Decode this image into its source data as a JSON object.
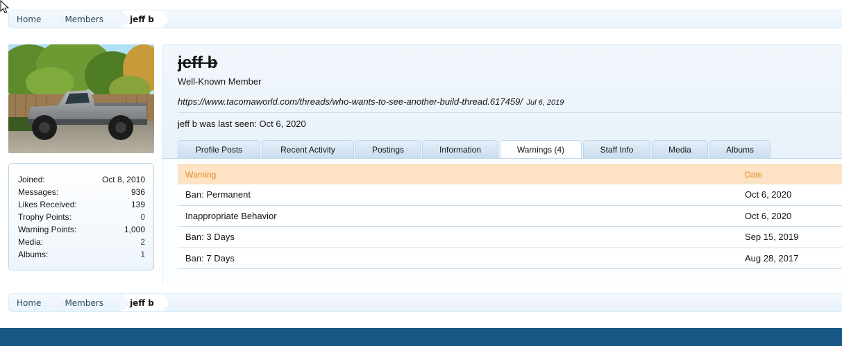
{
  "breadcrumb": {
    "items": [
      "Home",
      "Members",
      "jeff b"
    ]
  },
  "profile": {
    "username": "jeff b",
    "user_title": "Well-Known Member",
    "status_text": "https://www.tacomaworld.com/threads/who-wants-to-see-another-build-thread.617459/",
    "status_date": "Jul 6, 2019",
    "last_seen": "jeff b was last seen: Oct 6, 2020"
  },
  "stats": [
    {
      "label": "Joined:",
      "value": "Oct 8, 2010"
    },
    {
      "label": "Messages:",
      "value": "936"
    },
    {
      "label": "Likes Received:",
      "value": "139"
    },
    {
      "label": "Trophy Points:",
      "value": "0"
    },
    {
      "label": "Warning Points:",
      "value": "1,000"
    },
    {
      "label": "Media:",
      "value": "2"
    },
    {
      "label": "Albums:",
      "value": "1"
    }
  ],
  "tabs": [
    {
      "label": "Profile Posts"
    },
    {
      "label": "Recent Activity"
    },
    {
      "label": "Postings"
    },
    {
      "label": "Information"
    },
    {
      "label": "Warnings (4)"
    },
    {
      "label": "Staff Info"
    },
    {
      "label": "Media"
    },
    {
      "label": "Albums"
    }
  ],
  "active_tab": "Warnings (4)",
  "warnings_table": {
    "headers": [
      "Warning",
      "Date"
    ],
    "rows": [
      [
        "Ban: Permanent",
        "Oct 6, 2020"
      ],
      [
        "Inappropriate Behavior",
        "Oct 6, 2020"
      ],
      [
        "Ban: 3 Days",
        "Sep 15, 2019"
      ],
      [
        "Ban: 7 Days",
        "Aug 28, 2017"
      ]
    ]
  },
  "icons": {
    "cursor": "mouse-pointer-icon",
    "avatar": "truck-avatar-image"
  },
  "colors": {
    "footer": "#185886",
    "table_header_bg": "#fde3c4",
    "table_header_text": "#e08a1e",
    "link": "#2b485c"
  }
}
